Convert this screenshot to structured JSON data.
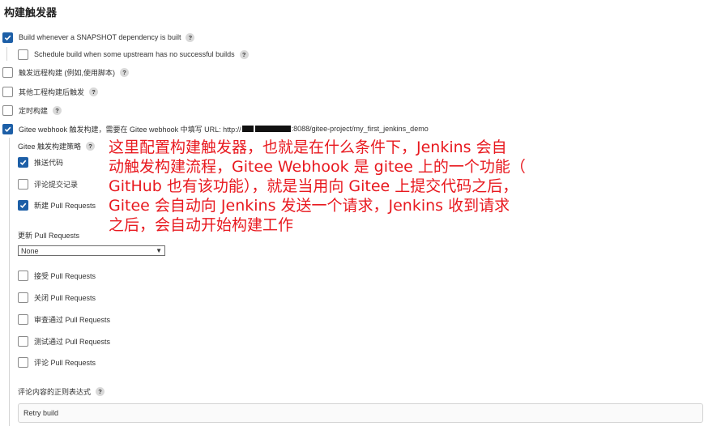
{
  "section": {
    "title": "构建触发器"
  },
  "triggers": [
    {
      "label": "Build whenever a SNAPSHOT dependency is built",
      "checked": true
    },
    {
      "label": "Schedule build when some upstream has no successful builds",
      "checked": false
    },
    {
      "label": "触发远程构建 (例如,使用脚本)",
      "checked": false
    },
    {
      "label": "其他工程构建后触发",
      "checked": false
    },
    {
      "label": "定时构建",
      "checked": false
    }
  ],
  "gitee": {
    "label_prefix": "Gitee webhook 触发构建，需要在 Gitee webhook 中填写 URL: http://",
    "label_suffix": ":8088/gitee-project/my_first_jenkins_demo",
    "checked": true,
    "strategy_label": "Gitee 触发构建策略",
    "strategies": [
      {
        "label": "推送代码",
        "checked": true
      },
      {
        "label": "评论提交记录",
        "checked": false
      },
      {
        "label": "新建 Pull Requests",
        "checked": true
      }
    ],
    "update_pr_label": "更新 Pull Requests",
    "update_pr_value": "None",
    "pr_actions": [
      {
        "label": "接受 Pull Requests",
        "checked": false
      },
      {
        "label": "关闭 Pull Requests",
        "checked": false
      },
      {
        "label": "审查通过 Pull Requests",
        "checked": false
      },
      {
        "label": "测试通过 Pull Requests",
        "checked": false
      },
      {
        "label": "评论 Pull Requests",
        "checked": false
      }
    ],
    "regex_label": "评论内容的正则表达式",
    "regex_value": "Retry build"
  },
  "help_symbol": "?",
  "annotation": {
    "lines": [
      "这里配置构建触发器，也就是在什么条件下，Jenkins 会自",
      "动触发构建流程，Gitee Webhook 是 gitee 上的一个功能（",
      "GitHub 也有该功能），就是当用向 Gitee 上提交代码之后，",
      "Gitee 会自动向 Jenkins 发送一个请求，Jenkins 收到请求",
      "之后，会自动开始构建工作"
    ]
  },
  "colors": {
    "checkbox_checked": "#1d5fa7",
    "annotation": "#e8191f"
  }
}
